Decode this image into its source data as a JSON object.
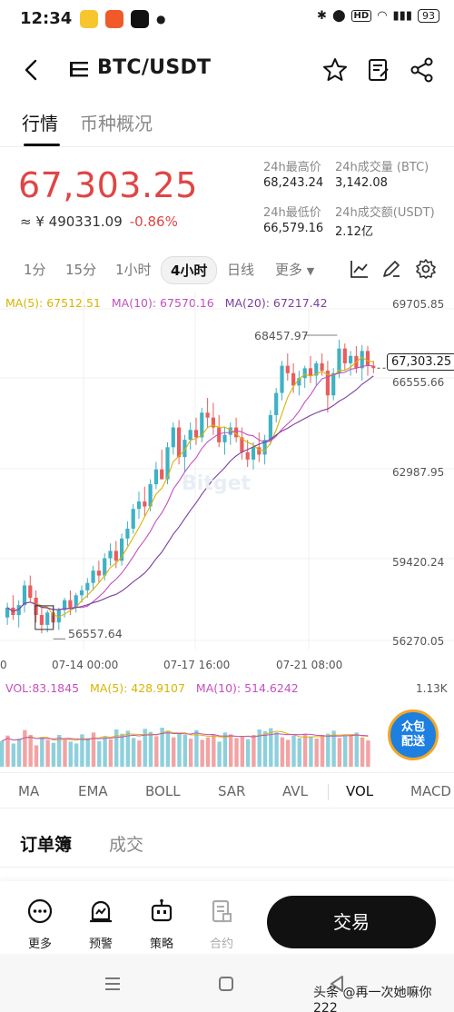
{
  "status_bar": {
    "time": "12:34",
    "battery": "93",
    "hd": "HD"
  },
  "header": {
    "title": "BTC/USDT"
  },
  "tabs": [
    "行情",
    "币种概况"
  ],
  "ticker": {
    "price": "67,303.25",
    "cny": "≈ ¥ 490331.09",
    "change": "-0.86%",
    "stats": [
      {
        "label": "24h最高价",
        "value": "68,243.24"
      },
      {
        "label": "24h成交量 (BTC)",
        "value": "3,142.08"
      },
      {
        "label": "24h最低价",
        "value": "66,579.16"
      },
      {
        "label": "24h成交额(USDT)",
        "value": "2.12亿"
      }
    ]
  },
  "timeframes": [
    "1分",
    "15分",
    "1小时",
    "4小时",
    "日线",
    "更多"
  ],
  "active_timeframe": "4小时",
  "ma_legend": {
    "ma5": "MA(5): 67512.51",
    "ma10": "MA(10): 67570.16",
    "ma20": "MA(20): 67217.42"
  },
  "chart_axis": {
    "y_labels": [
      "69705.85",
      "66555.66",
      "62987.95",
      "59420.24",
      "56270.05"
    ],
    "x_labels": [
      "07-14 00:00",
      "07-17 16:00",
      "07-21 08:00"
    ],
    "x_left": "0",
    "high_marker": "68457.97",
    "low_marker": "56557.64",
    "current_price": "67,303.25",
    "watermark": "Bitget"
  },
  "vol_legend": {
    "vol": "VOL:83.1845",
    "ma5": "MA(5): 428.9107",
    "ma10": "MA(10): 514.6242",
    "max": "1.13K"
  },
  "float_button": {
    "line1": "众包",
    "line2": "配送"
  },
  "indicators": [
    "MA",
    "EMA",
    "BOLL",
    "SAR",
    "AVL",
    "VOL",
    "MACD"
  ],
  "active_indicator": "VOL",
  "book_tabs": [
    "订单簿",
    "成交"
  ],
  "bottom_nav": [
    {
      "label": "更多",
      "icon": "more-icon"
    },
    {
      "label": "预警",
      "icon": "alert-icon"
    },
    {
      "label": "策略",
      "icon": "robot-icon"
    },
    {
      "label": "合约",
      "icon": "contract-icon"
    }
  ],
  "trade_button": "交易",
  "watermark": "头条 @再一次她嘛你222",
  "colors": {
    "up": "#3fb1c4",
    "down": "#e85d5d",
    "ma5": "#d9b400",
    "ma10": "#c44fbf",
    "ma20": "#7b3fa0"
  },
  "candles": [
    [
      57200,
      57800,
      56900,
      57600
    ],
    [
      57600,
      58100,
      57100,
      57300
    ],
    [
      57300,
      57900,
      56800,
      57700
    ],
    [
      57700,
      58700,
      57400,
      58500
    ],
    [
      58500,
      58900,
      57800,
      58000
    ],
    [
      58000,
      58300,
      57000,
      57300
    ],
    [
      57300,
      57600,
      56560,
      56900
    ],
    [
      56900,
      57500,
      56600,
      57400
    ],
    [
      57400,
      57700,
      56800,
      57000
    ],
    [
      57000,
      57600,
      56700,
      57500
    ],
    [
      57500,
      58000,
      57200,
      57900
    ],
    [
      57900,
      58300,
      57300,
      57600
    ],
    [
      57600,
      58200,
      57400,
      58100
    ],
    [
      58100,
      58500,
      57800,
      58300
    ],
    [
      58300,
      58800,
      58000,
      58600
    ],
    [
      58600,
      59300,
      58300,
      59100
    ],
    [
      59100,
      59500,
      58600,
      58900
    ],
    [
      58900,
      59800,
      58700,
      59600
    ],
    [
      59600,
      60200,
      59300,
      59900
    ],
    [
      59900,
      60300,
      59200,
      59500
    ],
    [
      59500,
      60600,
      59300,
      60400
    ],
    [
      60400,
      61100,
      60100,
      60800
    ],
    [
      60800,
      61800,
      60600,
      61600
    ],
    [
      61600,
      62300,
      61200,
      61900
    ],
    [
      61900,
      62500,
      61300,
      61700
    ],
    [
      61700,
      62800,
      61500,
      62600
    ],
    [
      62600,
      63500,
      62400,
      63200
    ],
    [
      63200,
      64000,
      62900,
      62800
    ],
    [
      62800,
      64300,
      62600,
      64100
    ],
    [
      64100,
      65100,
      63800,
      64900
    ],
    [
      64900,
      65200,
      63400,
      63700
    ],
    [
      63700,
      64600,
      63100,
      64400
    ],
    [
      64400,
      65100,
      64000,
      64800
    ],
    [
      64800,
      65300,
      64200,
      64500
    ],
    [
      64500,
      65700,
      64300,
      65500
    ],
    [
      65500,
      66100,
      64900,
      65300
    ],
    [
      65300,
      65900,
      64600,
      64900
    ],
    [
      64900,
      65400,
      64100,
      64300
    ],
    [
      64300,
      64900,
      63800,
      64600
    ],
    [
      64600,
      65100,
      64200,
      64900
    ],
    [
      64900,
      65300,
      64300,
      64500
    ],
    [
      64500,
      64900,
      63600,
      63900
    ],
    [
      63900,
      64400,
      63300,
      63600
    ],
    [
      63600,
      64300,
      63200,
      64100
    ],
    [
      64100,
      64700,
      63500,
      63800
    ],
    [
      63800,
      64600,
      63400,
      64400
    ],
    [
      64400,
      65600,
      64200,
      65400
    ],
    [
      65400,
      66500,
      65100,
      66300
    ],
    [
      66300,
      67600,
      66000,
      67400
    ],
    [
      67400,
      67900,
      66800,
      67100
    ],
    [
      67100,
      67500,
      66300,
      66600
    ],
    [
      66600,
      67200,
      66200,
      66900
    ],
    [
      66900,
      67400,
      66500,
      67300
    ],
    [
      67300,
      67800,
      66700,
      67000
    ],
    [
      67000,
      67600,
      66600,
      67500
    ],
    [
      67500,
      67900,
      67000,
      67200
    ],
    [
      67200,
      67600,
      65500,
      66200
    ],
    [
      66200,
      67300,
      66000,
      67100
    ],
    [
      67100,
      68458,
      66900,
      68100
    ],
    [
      68100,
      68300,
      67200,
      67500
    ],
    [
      67500,
      68000,
      67000,
      67800
    ],
    [
      67800,
      68200,
      67100,
      67300
    ],
    [
      67300,
      68243,
      66800,
      68000
    ],
    [
      68000,
      68200,
      67000,
      67400
    ],
    [
      67400,
      67600,
      67100,
      67303
    ]
  ],
  "volumes": [
    420,
    510,
    380,
    460,
    600,
    520,
    350,
    480,
    440,
    390,
    520,
    460,
    410,
    380,
    530,
    470,
    560,
    420,
    500,
    450,
    610,
    540,
    590,
    470,
    430,
    620,
    570,
    500,
    640,
    590,
    480,
    550,
    520,
    460,
    600,
    440,
    480,
    520,
    410,
    560,
    530,
    470,
    500,
    450,
    520,
    610,
    580,
    630,
    560,
    480,
    440,
    510,
    470,
    530,
    490,
    460,
    520,
    540,
    590,
    470,
    500,
    520,
    560,
    480,
    430
  ]
}
